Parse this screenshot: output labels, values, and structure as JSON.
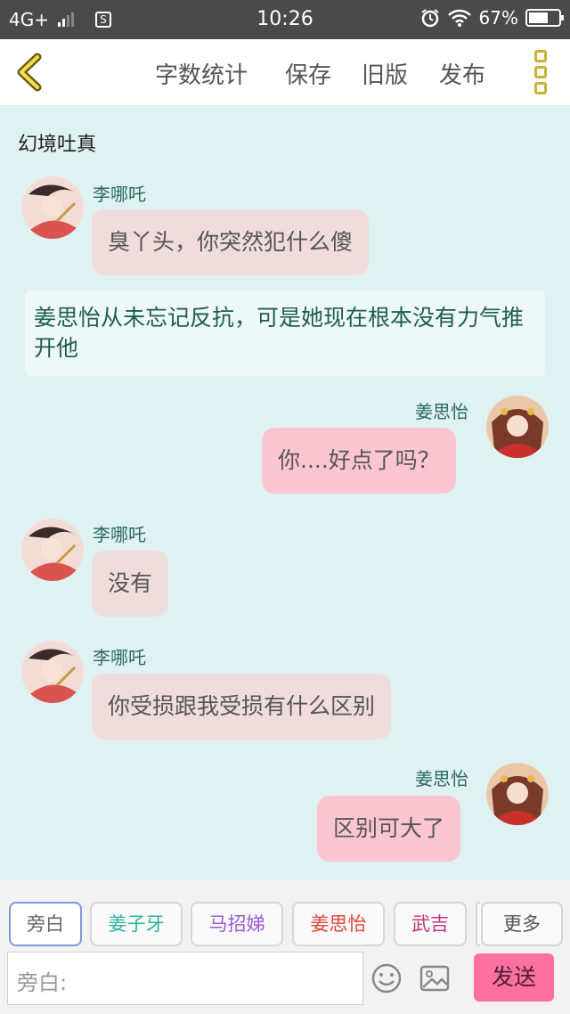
{
  "status_bar": {
    "network": "4G+",
    "sim_icon": "sim-card-icon",
    "time": "10:26",
    "battery_text": "67%",
    "battery_level": 0.67
  },
  "nav": {
    "back_icon": "chevron-left-icon",
    "word_count": "字数统计",
    "save": "保存",
    "old_version": "旧版",
    "publish": "发布",
    "more_icon": "more-vertical-icon"
  },
  "chat": {
    "title": "幻境吐真",
    "messages": [
      {
        "type": "other",
        "name": "李哪吒",
        "text": "臭丫头，你突然犯什么傻"
      },
      {
        "type": "narration",
        "text": "姜思怡从未忘记反抗，可是她现在根本没有力气推开他"
      },
      {
        "type": "self",
        "name": "姜思怡",
        "text": "你....好点了吗？"
      },
      {
        "type": "other",
        "name": "李哪吒",
        "text": "没有"
      },
      {
        "type": "other",
        "name": "李哪吒",
        "text": "你受损跟我受损有什么区别"
      },
      {
        "type": "self",
        "name": "姜思怡",
        "text": "区别可大了"
      }
    ]
  },
  "bottom": {
    "roles": [
      {
        "label": "旁白",
        "color": "#666666"
      },
      {
        "label": "姜子牙",
        "color": "#2bb3a0"
      },
      {
        "label": "马招娣",
        "color": "#9a5ad8"
      },
      {
        "label": "姜思怡",
        "color": "#e0433a"
      },
      {
        "label": "武吉",
        "color": "#c8337a"
      }
    ],
    "more": "更多",
    "input_placeholder": "旁白:",
    "emoji_icon": "smiley-icon",
    "image_icon": "image-icon",
    "send": "发送"
  }
}
